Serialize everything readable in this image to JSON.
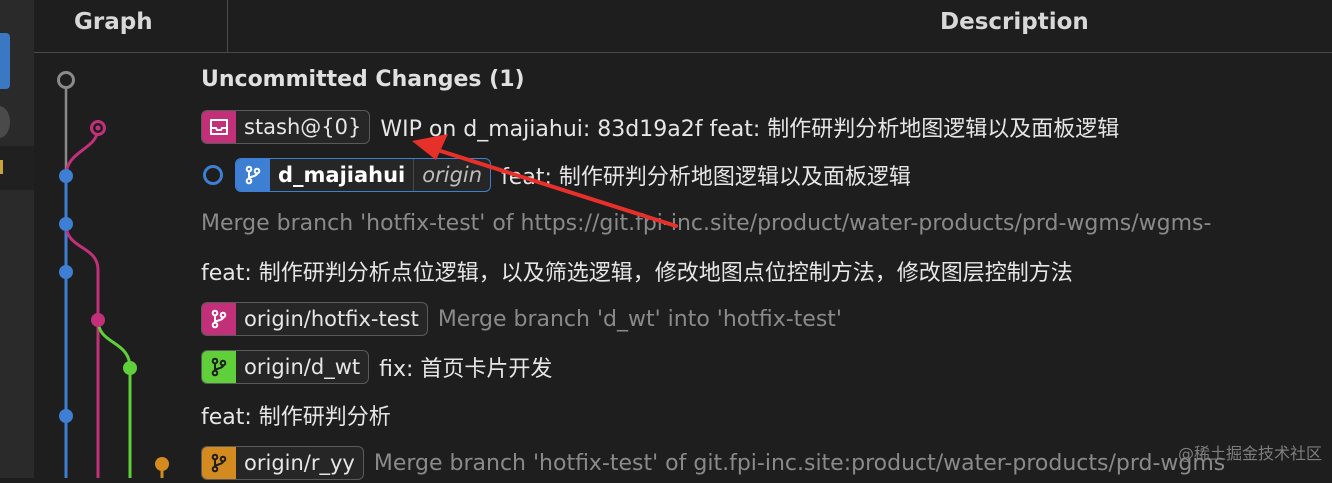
{
  "header": {
    "graph": "Graph",
    "description": "Description"
  },
  "rows": {
    "uncommitted": {
      "text": "Uncommitted Changes (1)"
    },
    "stash": {
      "tag": "stash@{0}",
      "text": "WIP on d_majiahui: 83d19a2f feat: 制作研判分析地图逻辑以及面板逻辑",
      "color": "#c2307a"
    },
    "head": {
      "tag": "d_majiahui",
      "remote": "origin",
      "text": "feat: 制作研判分析地图逻辑以及面板逻辑",
      "color": "#3d7fd2"
    },
    "merge1": {
      "text": "Merge branch 'hotfix-test' of https://git.fpi-inc.site/product/water-products/prd-wgms/wgms-"
    },
    "feat1": {
      "text": "feat: 制作研判分析点位逻辑，以及筛选逻辑，修改地图点位控制方法，修改图层控制方法"
    },
    "hotfix": {
      "tag": "origin/hotfix-test",
      "text": "Merge branch 'd_wt' into 'hotfix-test'",
      "color": "#c2307a"
    },
    "dwt": {
      "tag": "origin/d_wt",
      "text": "fix: 首页卡片开发",
      "color": "#5fcf3a"
    },
    "feat2": {
      "text": "feat: 制作研判分析"
    },
    "ryy": {
      "tag": "origin/r_yy",
      "text": "Merge branch 'hotfix-test' of git.fpi-inc.site:product/water-products/prd-wgms",
      "color": "#d38a1e"
    }
  },
  "watermark": "@稀土掘金技术社区",
  "icons": {
    "stash": "stash-icon",
    "branch": "branch-icon"
  }
}
